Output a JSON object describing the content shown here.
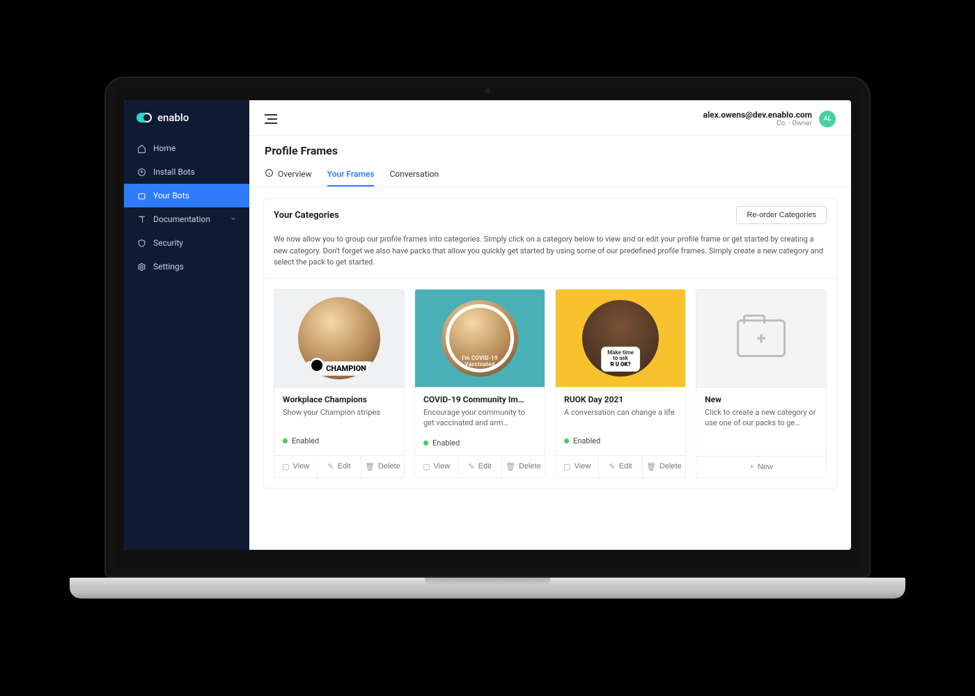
{
  "brand": {
    "name": "enablo"
  },
  "sidebar": {
    "items": [
      {
        "label": "Home"
      },
      {
        "label": "Install Bots"
      },
      {
        "label": "Your Bots"
      },
      {
        "label": "Documentation"
      },
      {
        "label": "Security"
      },
      {
        "label": "Settings"
      }
    ]
  },
  "user": {
    "email": "alex.owens@dev.enablo.com",
    "role": "Co. · Owner",
    "initials": "AL"
  },
  "page": {
    "title": "Profile Frames"
  },
  "tabs": [
    {
      "label": "Overview"
    },
    {
      "label": "Your Frames"
    },
    {
      "label": "Conversation"
    }
  ],
  "section": {
    "heading": "Your Categories",
    "reorder_btn": "Re-order Categories",
    "description": "We now allow you to group our profile frames into categories. Simply click on a category below to view and or edit your profile frame or get started by creating a new category. Don't forget we also have packs that allow you quickly get started by using some of our predefined profile frames. Simply create a new category and select the pack to get started."
  },
  "actions": {
    "view": "View",
    "edit": "Edit",
    "delete": "Delete",
    "new": "New"
  },
  "status_labels": {
    "enabled": "Enabled"
  },
  "cards": [
    {
      "title": "Workplace Champions",
      "desc": "Show your Champion stripes",
      "status": "Enabled",
      "badge": "CHAMPION"
    },
    {
      "title": "COVID-19 Community Im…",
      "desc": "Encourage your community to get vaccinated and arm…",
      "status": "Enabled",
      "ring_text": "I'm COVID-19 Vaccinated"
    },
    {
      "title": "RUOK Day 2021",
      "desc": "A conversation can change a life",
      "status": "Enabled",
      "bubble_line1": "Make time",
      "bubble_line2": "to ask",
      "bubble_line3": "R U OK?"
    },
    {
      "title": "New",
      "desc": "Click to create a new category or use one of our packs to ge…"
    }
  ]
}
